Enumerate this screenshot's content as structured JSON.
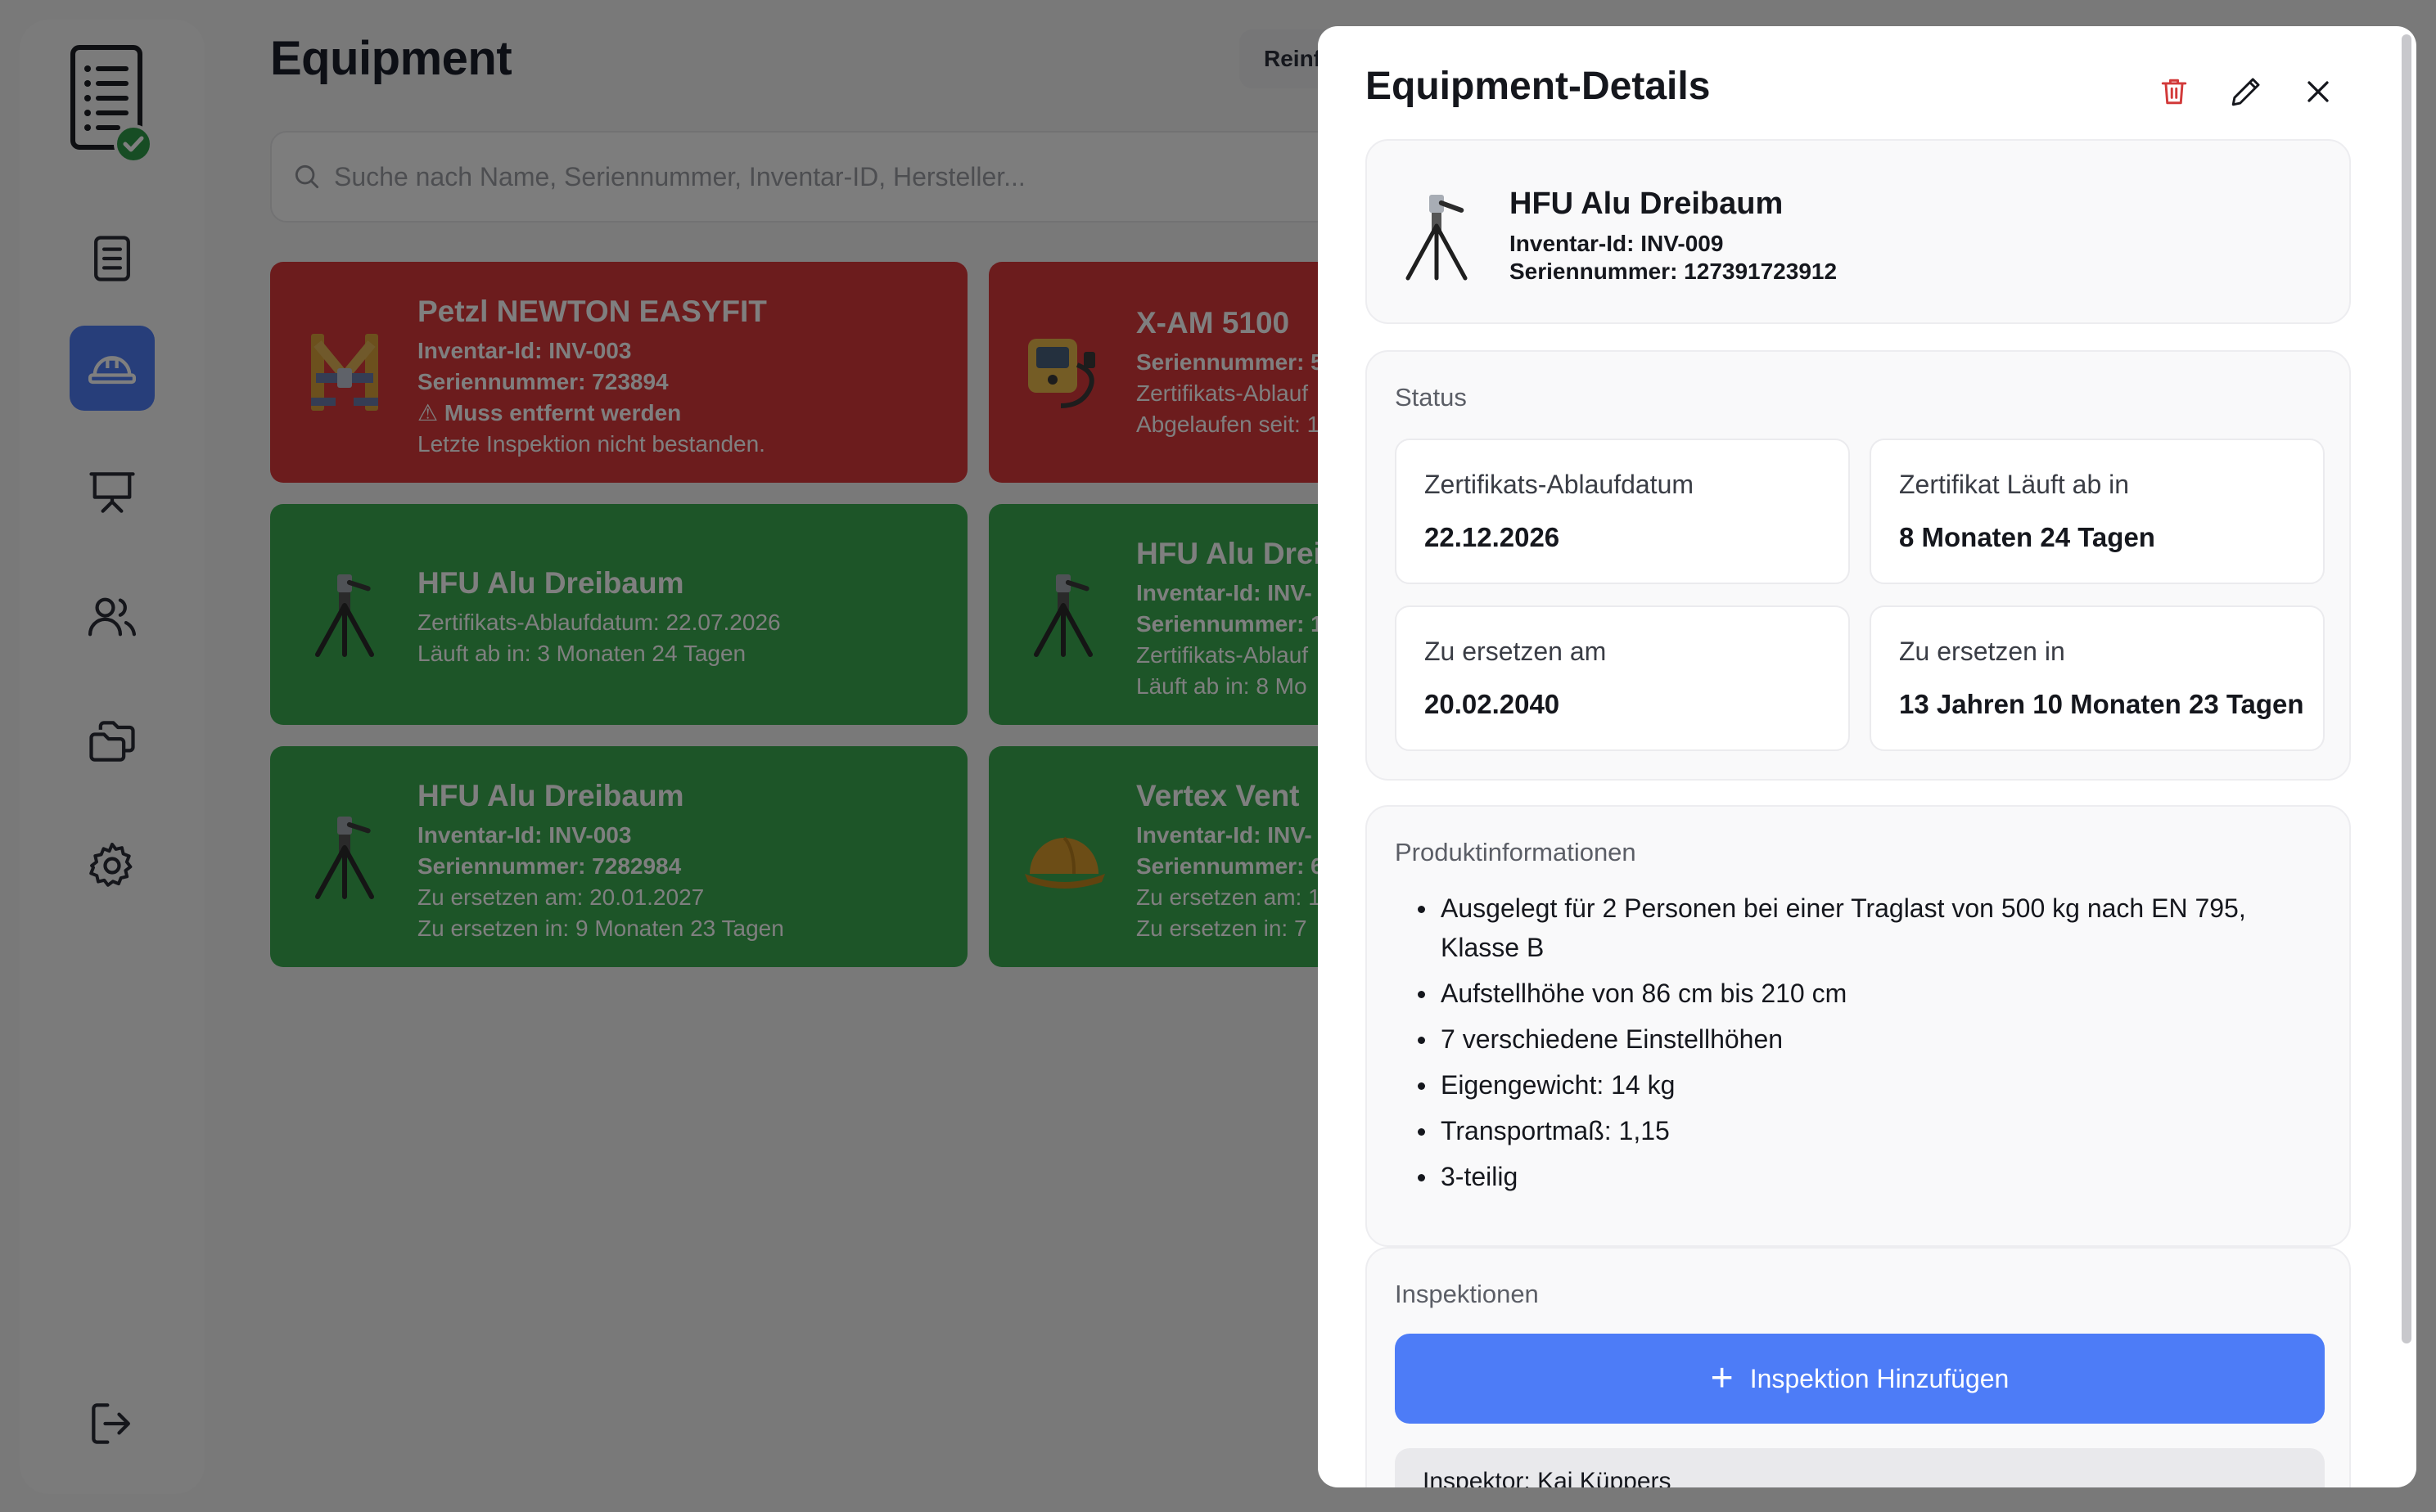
{
  "sidebar": {
    "items": [
      {
        "name": "protocols",
        "icon": "document-list-icon"
      },
      {
        "name": "equipment",
        "icon": "helmet-icon",
        "active": true
      },
      {
        "name": "presentation",
        "icon": "presentation-board-icon"
      },
      {
        "name": "users",
        "icon": "users-icon"
      },
      {
        "name": "files",
        "icon": "folders-icon"
      },
      {
        "name": "settings",
        "icon": "gear-icon"
      },
      {
        "name": "logout",
        "icon": "logout-icon"
      }
    ]
  },
  "main": {
    "title": "Equipment",
    "top_button_label": "Reinf",
    "search_placeholder": "Suche nach Name, Seriennummer, Inventar-ID, Hersteller...",
    "cards": [
      {
        "color": "red",
        "name": "Petzl NEWTON EASYFIT",
        "lines": [
          "Inventar-Id: INV-003",
          "Seriennummer: 723894",
          "⚠ Muss entfernt werden",
          "Letzte Inspektion nicht bestanden."
        ]
      },
      {
        "color": "red",
        "name": "X-AM 5100",
        "lines": [
          "Seriennummer: 5",
          "Zertifikats-Ablauf",
          "Abgelaufen seit: 1"
        ]
      },
      {
        "color": "green",
        "name": "HFU Alu Dreibaum",
        "lines": [
          "Zertifikats-Ablaufdatum: 22.07.2026",
          "Läuft ab in: 3 Monaten 24 Tagen"
        ]
      },
      {
        "color": "green",
        "name": "HFU Alu Drei",
        "lines": [
          "Inventar-Id: INV-",
          "Seriennummer: 1",
          "Zertifikats-Ablauf",
          "Läuft ab in: 8 Mo"
        ]
      },
      {
        "color": "green",
        "name": "HFU Alu Dreibaum",
        "lines": [
          "Inventar-Id: INV-003",
          "Seriennummer: 7282984",
          "Zu ersetzen am: 20.01.2027",
          "Zu ersetzen in: 9 Monaten 23 Tagen"
        ]
      },
      {
        "color": "green",
        "name": "Vertex Vent",
        "lines": [
          "Inventar-Id: INV-",
          "Seriennummer: 6",
          "Zu ersetzen am: 1",
          "Zu ersetzen in: 7"
        ]
      }
    ]
  },
  "panel": {
    "title": "Equipment-Details",
    "equipment": {
      "name": "HFU Alu Dreibaum",
      "inventory": "Inventar-Id: INV-009",
      "serial": "Seriennummer: 127391723912"
    },
    "status": {
      "label": "Status",
      "tiles": [
        {
          "label": "Zertifikats-Ablaufdatum",
          "value": "22.12.2026"
        },
        {
          "label": "Zertifikat Läuft ab in",
          "value": "8 Monaten 24 Tagen"
        },
        {
          "label": "Zu ersetzen am",
          "value": "20.02.2040"
        },
        {
          "label": "Zu ersetzen in",
          "value": "13 Jahren 10 Monaten 23 Tagen"
        }
      ]
    },
    "product": {
      "label": "Produktinformationen",
      "items": [
        "Ausgelegt für 2 Personen bei einer Traglast von 500 kg nach EN 795, Klasse B",
        "Aufstellhöhe von 86 cm bis 210 cm",
        "7 verschiedene Einstellhöhen",
        "Eigengewicht: 14 kg",
        "Transportmaß: 1,15",
        "3-teilig"
      ]
    },
    "inspections": {
      "label": "Inspektionen",
      "add_label": "Inspektion Hinzufügen",
      "first_item": "Inspektor: Kai Küppers"
    }
  },
  "colors": {
    "accent": "#4d7cf7",
    "danger": "#d9383a",
    "success": "#3aaa51",
    "delete_icon": "#d23a3a"
  }
}
